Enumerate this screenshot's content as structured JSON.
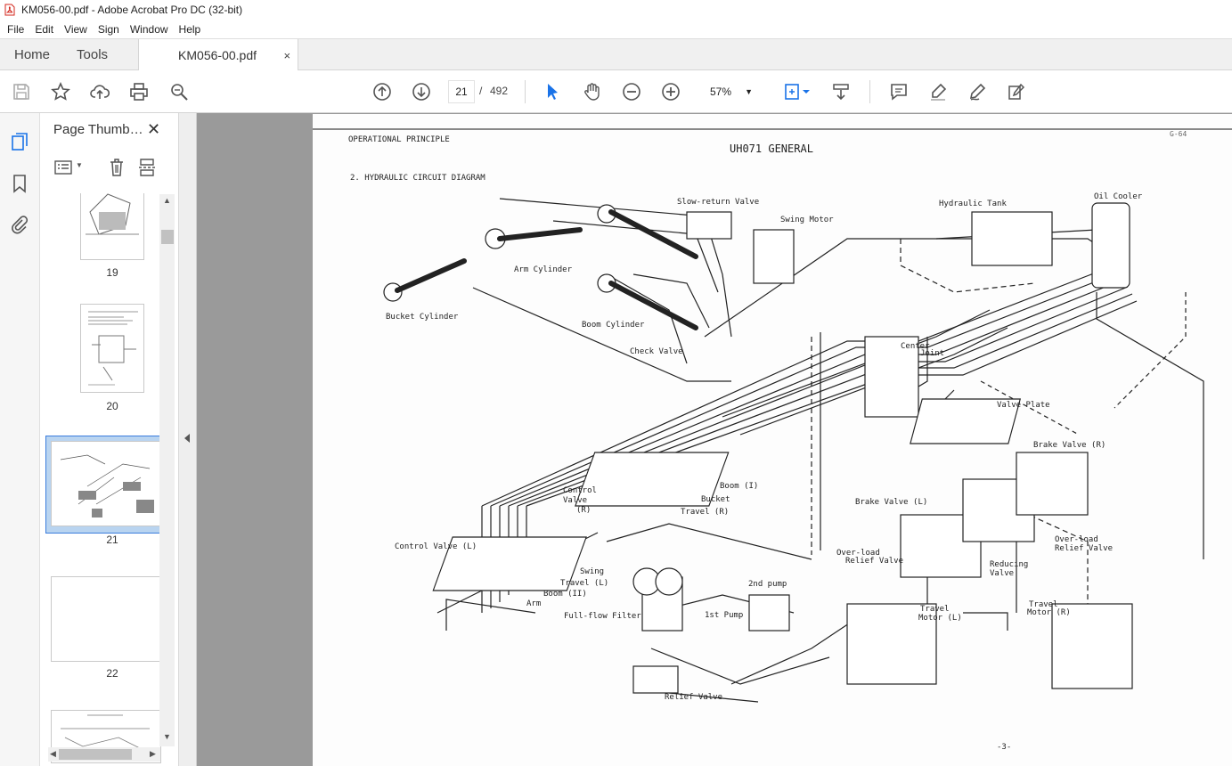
{
  "window": {
    "title": "KM056-00.pdf - Adobe Acrobat Pro DC (32-bit)"
  },
  "menu": [
    "File",
    "Edit",
    "View",
    "Sign",
    "Window",
    "Help"
  ],
  "tabs": {
    "home": "Home",
    "tools": "Tools",
    "document": "KM056-00.pdf",
    "close": "×"
  },
  "toolbar": {
    "current_page": "21",
    "page_separator": "/",
    "total_pages": "492",
    "zoom": "57%"
  },
  "thumbnail_panel": {
    "title": "Page Thumb…",
    "close": "✕",
    "pages": [
      {
        "label": "19"
      },
      {
        "label": "20"
      },
      {
        "label": "21",
        "selected": true
      },
      {
        "label": "22"
      }
    ]
  },
  "document": {
    "header_left": "OPERATIONAL PRINCIPLE",
    "header_right": "G-64",
    "title": "UH071 GENERAL",
    "section": "2. HYDRAULIC CIRCUIT DIAGRAM",
    "page_number": "-3-",
    "labels": {
      "slow_return_valve": "Slow-return Valve",
      "swing_motor": "Swing Motor",
      "hydraulic_tank": "Hydraulic Tank",
      "oil_cooler": "Oil Cooler",
      "arm_cylinder": "Arm Cylinder",
      "bucket_cylinder": "Bucket Cylinder",
      "boom_cylinder": "Boom Cylinder",
      "center_joint_1": "Center",
      "center_joint_2": "Joint",
      "check_valve": "Check Valve",
      "valve_plate": "Valve Plate",
      "brake_valve_r": "Brake Valve (R)",
      "brake_valve_l": "Brake Valve (L)",
      "control_valve_r_1": "Control",
      "control_valve_r_2": "Valve",
      "control_valve_r_3": "(R)",
      "boom_1": "Boom (I)",
      "bucket": "Bucket",
      "travel_r": "Travel (R)",
      "control_valve_l": "Control Valve (L)",
      "swing": "Swing",
      "travel_l": "Travel (L)",
      "boom_2": "Boom (II)",
      "arm": "Arm",
      "overload_l_1": "Over-load",
      "overload_l_2": "Relief Valve",
      "overload_r_1": "Over-load",
      "overload_r_2": "Relief Valve",
      "reducing_1": "Reducing",
      "reducing_2": "Valve",
      "pump2": "2nd pump",
      "pump1": "1st Pump",
      "filter": "Full-flow Filter",
      "relief_valve": "Relief Valve",
      "travel_motor_l_1": "Travel",
      "travel_motor_l_2": "Motor (L)",
      "travel_motor_r_1": "Travel",
      "travel_motor_r_2": "Motor (R)"
    }
  }
}
